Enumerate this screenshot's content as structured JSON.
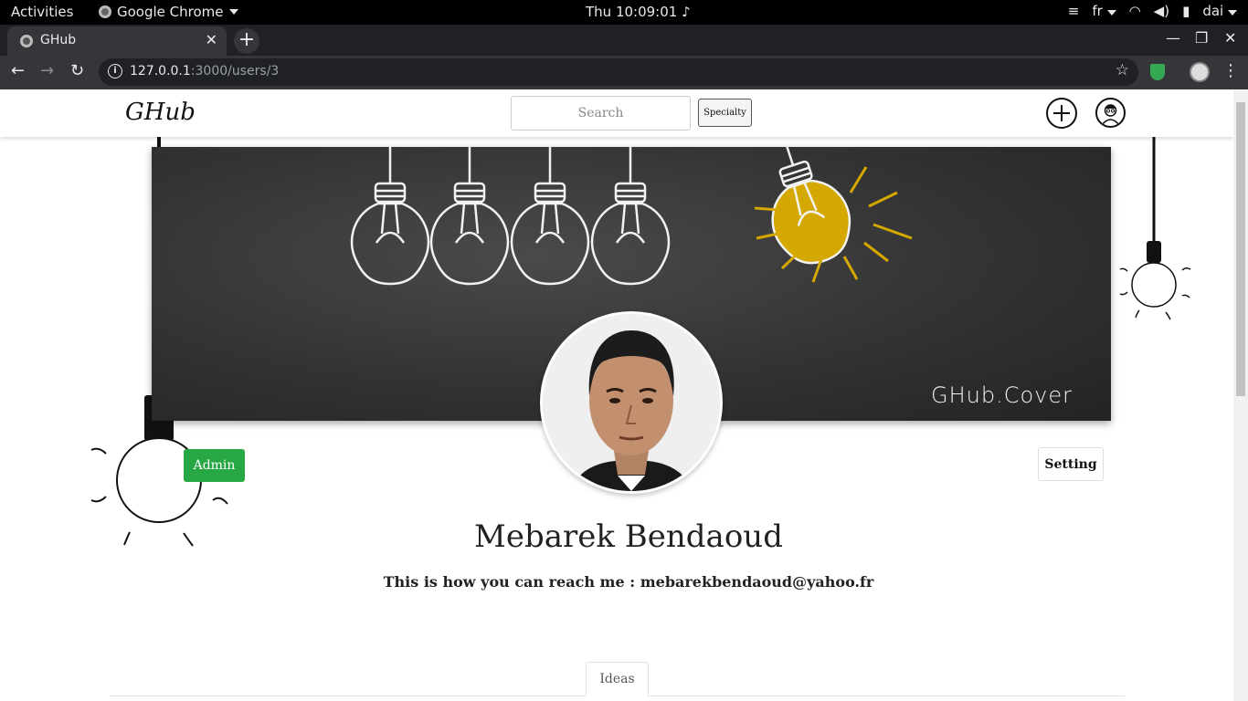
{
  "os_bar": {
    "activities": "Activities",
    "app_name": "Google Chrome",
    "clock": "Thu 10:09:01",
    "lang": "fr",
    "user": "dai"
  },
  "browser": {
    "tab_title": "GHub",
    "url_host": "127.0.0.1",
    "url_path": ":3000/users/3"
  },
  "site": {
    "brand": "GHub",
    "search_placeholder": "Search",
    "specialty_label": "Specialty"
  },
  "cover": {
    "caption": "GHub.Cover"
  },
  "profile": {
    "admin_label": "Admin",
    "setting_label": "Setting",
    "name": "Mebarek Bendaoud",
    "contact": "This is how you can reach me : mebarekbendaoud@yahoo.fr"
  },
  "tabs": {
    "ideas": "Ideas"
  },
  "colors": {
    "admin_green": "#28a745",
    "bulb_yellow": "#d4a800",
    "cover_dark": "#333333"
  }
}
